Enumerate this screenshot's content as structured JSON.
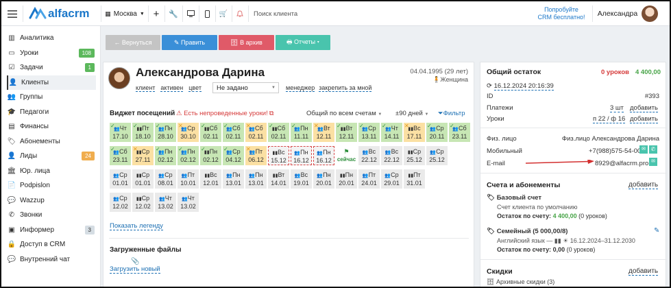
{
  "topbar": {
    "logo": "alfacrm",
    "city": "Москва",
    "search_placeholder": "Поиск клиента",
    "trial_line1": "Попробуйте",
    "trial_line2": "CRM бесплатно!",
    "user": "Александра"
  },
  "sidebar": {
    "items": [
      {
        "label": "Аналитика",
        "icon": "report-icon"
      },
      {
        "label": "Уроки",
        "icon": "desktop-icon",
        "badge": "108",
        "badge_color": "#5cb85c"
      },
      {
        "label": "Задачи",
        "icon": "tasks-icon",
        "badge": "1",
        "badge_color": "#5cb85c"
      },
      {
        "label": "Клиенты",
        "icon": "user-icon",
        "active": true
      },
      {
        "label": "Группы",
        "icon": "group-icon"
      },
      {
        "label": "Педагоги",
        "icon": "graduation-cap-icon"
      },
      {
        "label": "Финансы",
        "icon": "money-icon"
      },
      {
        "label": "Абонементы",
        "icon": "tag-icon"
      },
      {
        "label": "Лиды",
        "icon": "user-plus-icon",
        "badge": "24",
        "badge_color": "#f0ad4e"
      },
      {
        "label": "Юр. лица",
        "icon": "bank-icon"
      },
      {
        "label": "Podpislon",
        "icon": "file-icon"
      },
      {
        "label": "Wazzup",
        "icon": "chat-icon"
      },
      {
        "label": "Звонки",
        "icon": "phone-icon"
      },
      {
        "label": "Информер",
        "icon": "inbox-icon",
        "badge": "3",
        "badge_color": "#d5dde3"
      },
      {
        "label": "Доступ в CRM",
        "icon": "lock-icon"
      },
      {
        "label": "Внутренний чат",
        "icon": "comments-icon"
      }
    ]
  },
  "actions": {
    "back": "← Вернуться",
    "edit": "✎ Править",
    "archive": "🗄 В архив",
    "reports": "🖶 Отчеты ▾"
  },
  "client": {
    "name": "Александрова Дарина",
    "birth": "04.04.1995 (29 лет)",
    "gender": "Женщина",
    "tabs": [
      "клиент",
      "активен",
      "цвет"
    ],
    "status": "Не задано",
    "manager": "менеджер",
    "pin": "закрепить за мной"
  },
  "widget": {
    "title": "Виджет посещений",
    "warning": "Есть непроведенные уроки!",
    "filter1": "Общий по всем счетам",
    "filter2": "±90 дней",
    "filter3": "Фильтр",
    "legend": "Показать легенду",
    "now": "сейчас"
  },
  "visits": [
    [
      "g",
      "Чт",
      "17.10",
      "g"
    ],
    [
      "g",
      "Пт",
      "18.10",
      "g"
    ],
    [
      "g",
      "Пн",
      "28.10",
      "g"
    ],
    [
      "y",
      "Ср",
      "30.10",
      "o"
    ],
    [
      "g",
      "Сб",
      "02.11",
      "g"
    ],
    [
      "g",
      "Сб",
      "02.11",
      "g"
    ],
    [
      "y",
      "Сб",
      "02.11",
      "o"
    ],
    [
      "g",
      "Сб",
      "02.11",
      "g"
    ],
    [
      "g",
      "Пн",
      "11.11",
      "g"
    ],
    [
      "y",
      "Вт",
      "12.11",
      "o"
    ],
    [
      "g",
      "Вт",
      "12.11",
      "g"
    ],
    [
      "g",
      "Ср",
      "13.11",
      "g"
    ],
    [
      "g",
      "Чт",
      "14.11",
      "g"
    ],
    [
      "y",
      "Вс",
      "17.11",
      "o"
    ],
    [
      "g",
      "Ср",
      "20.11",
      "g"
    ],
    [
      "g",
      "Сб",
      "23.11",
      "g"
    ],
    [
      "g",
      "Сб",
      "23.11",
      "g"
    ],
    [
      "y",
      "Ср",
      "27.11",
      "o"
    ],
    [
      "g",
      "Пн",
      "02.12",
      "g"
    ],
    [
      "g",
      "Пн",
      "02.12",
      "g"
    ],
    [
      "g",
      "Пн",
      "02.12",
      "g"
    ],
    [
      "g",
      "Ср",
      "04.12",
      "g"
    ],
    [
      "y",
      "Пт",
      "06.12",
      "o"
    ],
    [
      "d",
      "Вс",
      "15.12",
      ""
    ],
    [
      "d",
      "Пн",
      "16.12",
      ""
    ],
    [
      "d",
      "Пн",
      "16.12",
      ""
    ],
    [
      "now",
      "",
      "",
      ""
    ],
    [
      "gr",
      "Вс",
      "22.12",
      ""
    ],
    [
      "gr",
      "Вс",
      "22.12",
      ""
    ],
    [
      "gr",
      "Ср",
      "25.12",
      ""
    ],
    [
      "gr",
      "Ср",
      "25.12",
      ""
    ],
    [
      "gr",
      "Ср",
      "01.01",
      ""
    ],
    [
      "gr",
      "Ср",
      "01.01",
      ""
    ],
    [
      "gr",
      "Ср",
      "08.01",
      ""
    ],
    [
      "gr",
      "Пт",
      "10.01",
      ""
    ],
    [
      "gr",
      "Вс",
      "12.01",
      ""
    ],
    [
      "gr",
      "Пн",
      "13.01",
      ""
    ],
    [
      "gr",
      "Пн",
      "13.01",
      ""
    ],
    [
      "gr",
      "Вт",
      "14.01",
      ""
    ],
    [
      "gr",
      "Вс",
      "19.01",
      ""
    ],
    [
      "gr",
      "Пн",
      "20.01",
      ""
    ],
    [
      "gr",
      "Пн",
      "20.01",
      ""
    ],
    [
      "gr",
      "Пт",
      "24.01",
      ""
    ],
    [
      "gr",
      "Ср",
      "29.01",
      ""
    ],
    [
      "gr",
      "Пт",
      "31.01",
      ""
    ],
    [
      "gr",
      "Ср",
      "12.02",
      ""
    ],
    [
      "gr",
      "Ср",
      "12.02",
      ""
    ],
    [
      "gr",
      "Чт",
      "13.02",
      ""
    ],
    [
      "gr",
      "Чт",
      "13.02",
      ""
    ]
  ],
  "files": {
    "title": "Загруженные файлы",
    "upload": "Загрузить новый"
  },
  "balance": {
    "title": "Общий остаток",
    "lessons": "0 уроков",
    "amount": "4 400,00",
    "date": "16.12.2024 20:16:39",
    "id_label": "ID",
    "id": "#393",
    "pay_label": "Платежи",
    "pay_count": "3 шт",
    "pay_add": "добавить",
    "lessons_label": "Уроки",
    "lessons_val": "п 22 / ф 16",
    "lessons_add": "добавить"
  },
  "contacts": {
    "person_label": "Физ. лицо",
    "person": "Физ.лицо Александрова Дарина",
    "mobile_label": "Мобильный",
    "mobile": "+7(988)575-54-00",
    "email_label": "E-mail",
    "email": "8929@alfacrm.pro"
  },
  "accounts": {
    "title": "Счета и абонементы",
    "add": "добавить",
    "base_title": "Базовый счет",
    "base_desc": "Счет клиента по умолчанию",
    "base_rest_label": "Остаток по счету:",
    "base_rest": "4 400,00",
    "base_lessons": "(0 уроков)",
    "fam_title": "Семейный (5 000,00/8)",
    "fam_desc": "Английский язык — ",
    "fam_dates": "16.12.2024–31.12.2030",
    "fam_rest_label": "Остаток по счету:",
    "fam_rest": "0,00",
    "fam_lessons": "(0 уроков)"
  },
  "discounts": {
    "title": "Скидки",
    "add": "добавить",
    "archive": "Архивные скидки (3)"
  }
}
